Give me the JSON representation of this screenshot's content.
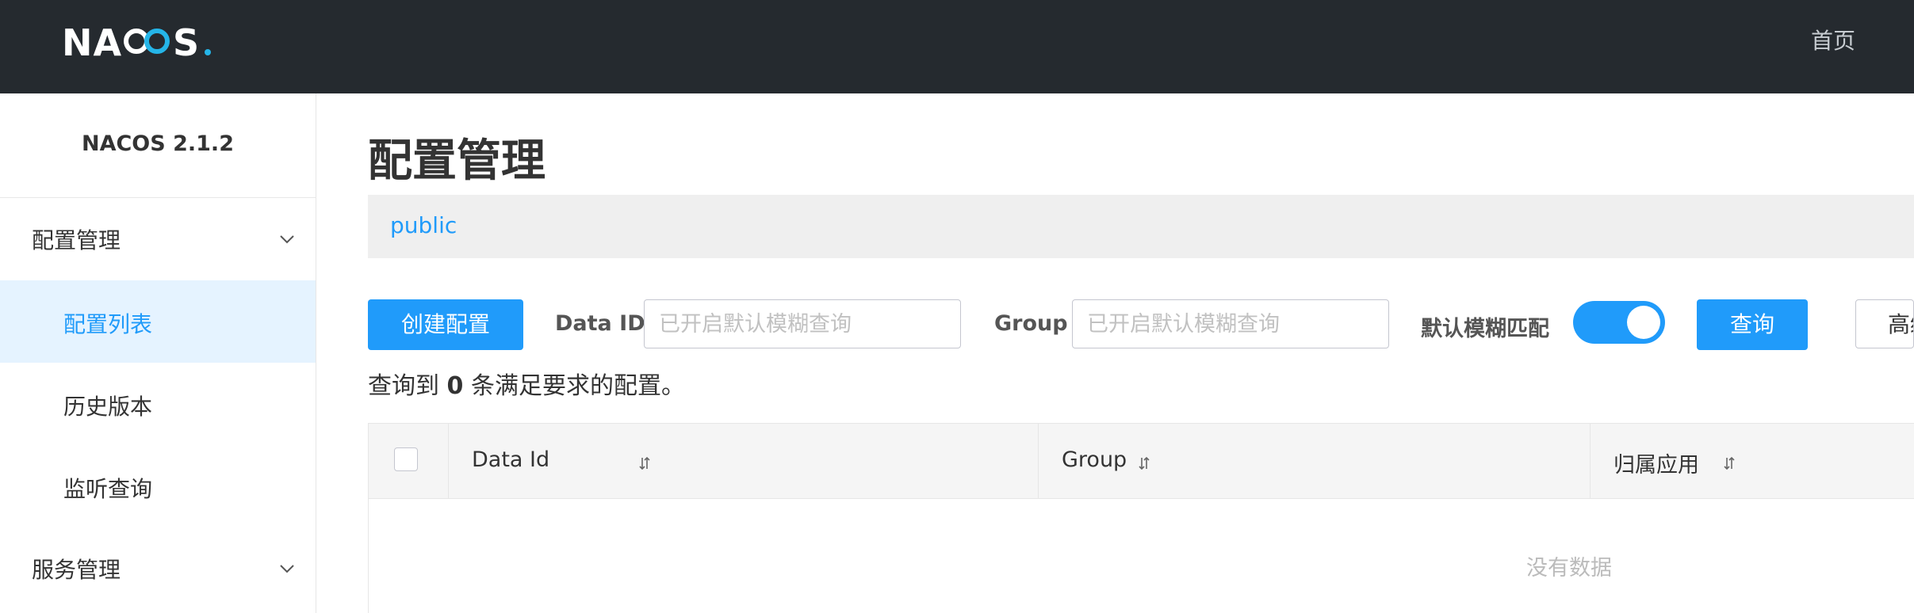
{
  "header": {
    "logo_text": "NACOS.",
    "home_label": "首页"
  },
  "sidebar": {
    "version": "NACOS 2.1.2",
    "groups": [
      {
        "label": "配置管理",
        "items": [
          {
            "label": "配置列表",
            "active": true
          },
          {
            "label": "历史版本",
            "active": false
          },
          {
            "label": "监听查询",
            "active": false
          }
        ]
      },
      {
        "label": "服务管理"
      }
    ]
  },
  "main": {
    "title": "配置管理",
    "namespace": "public",
    "toolbar": {
      "create_button": "创建配置",
      "data_id_label": "Data ID",
      "data_id_placeholder": "已开启默认模糊查询",
      "group_label": "Group",
      "group_placeholder": "已开启默认模糊查询",
      "fuzzy_label": "默认模糊匹配",
      "fuzzy_enabled": true,
      "query_button": "查询",
      "advanced_button": "高级查询"
    },
    "result": {
      "prefix": "查询到",
      "count": "0",
      "suffix": "条满足要求的配置。"
    },
    "table": {
      "columns": [
        "Data Id",
        "Group",
        "归属应用"
      ],
      "rows": [],
      "empty_text": "没有数据"
    }
  },
  "colors": {
    "header_bg": "#252a2f",
    "accent": "#209bfa",
    "active_bg": "#e5f3ff"
  },
  "icons": [
    "chevron-down-icon",
    "sort-icon",
    "checkbox-icon"
  ]
}
